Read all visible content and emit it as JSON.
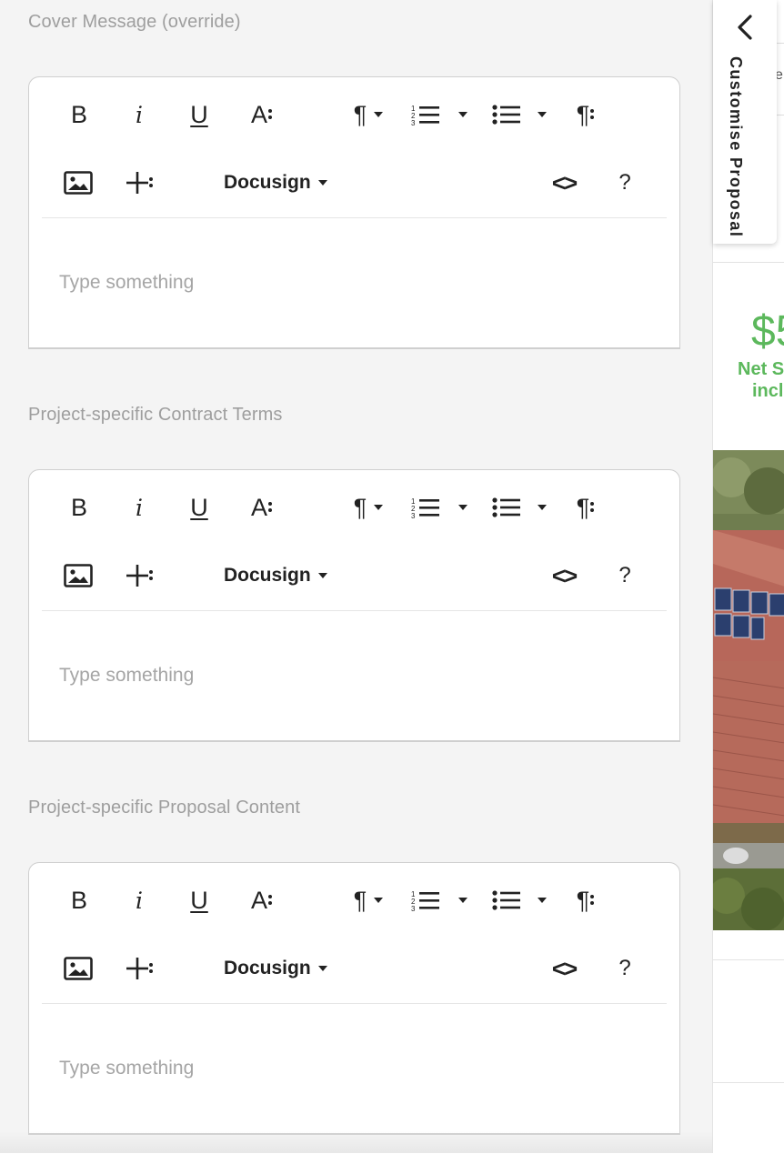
{
  "sections": [
    {
      "label": "Cover Message (override)",
      "placeholder": "Type something"
    },
    {
      "label": "Project-specific Contract Terms",
      "placeholder": "Type something"
    },
    {
      "label": "Project-specific Proposal Content",
      "placeholder": "Type something"
    }
  ],
  "toolbar": {
    "bold": "B",
    "italic": "i",
    "underline": "U",
    "font_size": "A",
    "paragraph": "¶",
    "paragraph_more": "¶",
    "docusign": "Docusign",
    "code": "<>",
    "help": "?"
  },
  "side_tab": {
    "label": "Customise Proposal",
    "peek_letter": "e"
  },
  "price_panel": {
    "price": "$5",
    "line1": "Net S",
    "line2": "incl"
  },
  "colors": {
    "accent_green": "#5cb85c",
    "placeholder_gray": "#a5a5a5",
    "label_gray": "#9e9e9e"
  }
}
